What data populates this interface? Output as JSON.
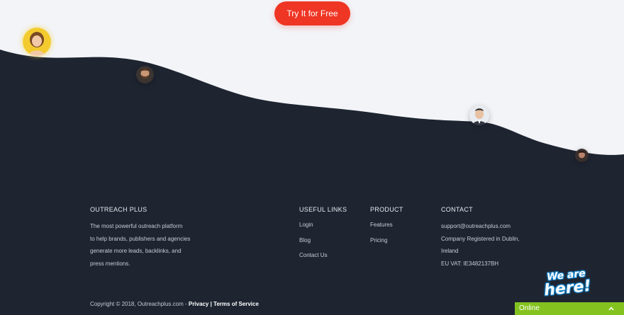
{
  "hero": {
    "cta_label": "Try It for Free"
  },
  "colors": {
    "light_bg": "#f2f4f8",
    "dark_bg": "#1e2531",
    "cta": "#ef3524",
    "online": "#84c31f"
  },
  "footer": {
    "brand": {
      "title": "OUTREACH PLUS",
      "description_lines": [
        "The most powerful outreach platform",
        "to help brands, publishers and agencies",
        "generate more leads, backlinks, and",
        "press mentions."
      ]
    },
    "useful_links": {
      "title": "USEFUL LINKS",
      "items": [
        "Login",
        "Blog",
        "Contact Us"
      ]
    },
    "product": {
      "title": "PRODUCT",
      "items": [
        "Features",
        "Pricing"
      ]
    },
    "contact": {
      "title": "CONTACT",
      "lines": [
        "support@outreachplus.com",
        "Company Registered in Dublin,",
        "Ireland",
        "EU VAT: IE3482137BH"
      ]
    },
    "copyright": {
      "text": "Copyright © 2018, Outreachplus.com - ",
      "privacy": "Privacy",
      "separator": "|",
      "terms": "Terms of Service"
    }
  },
  "chat_widget": {
    "line1": "We are",
    "line2": "here!",
    "status": "Online",
    "chevron_icon": "chevron-up-icon"
  }
}
